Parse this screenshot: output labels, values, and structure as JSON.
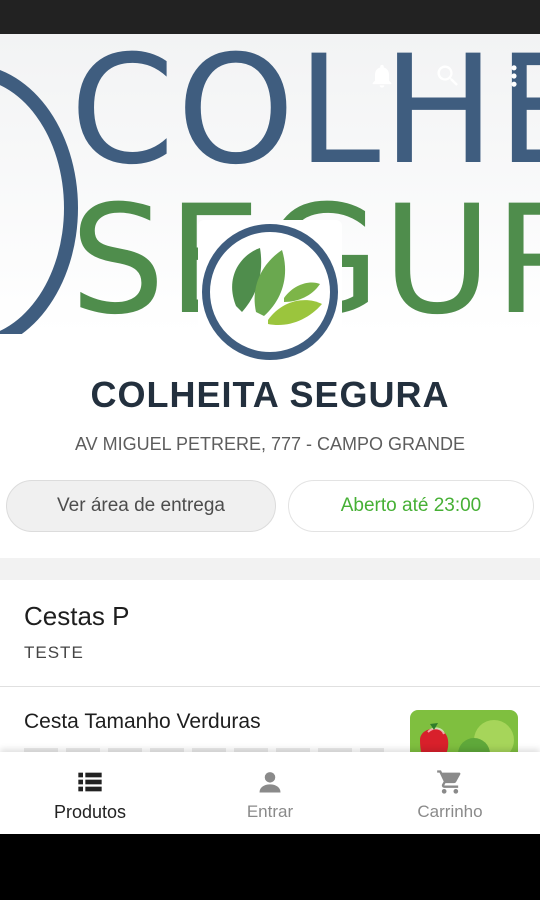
{
  "header": {
    "banner_word_top": "COLHE",
    "banner_word_bottom": "SEGUR",
    "actions": [
      {
        "icon": "bell-icon"
      },
      {
        "icon": "search-icon"
      },
      {
        "icon": "more-vert-icon"
      }
    ]
  },
  "store": {
    "name": "COLHEITA SEGURA",
    "address": "AV MIGUEL PETRERE, 777 - CAMPO GRANDE",
    "delivery_button": "Ver área de entrega",
    "hours_label": "Aberto até 23:00"
  },
  "catalog": {
    "category_title": "Cestas P",
    "category_subtitle": "TESTE",
    "products": [
      {
        "name": "Cesta Tamanho Verduras"
      }
    ]
  },
  "bottom_nav": {
    "items": [
      {
        "label": "Produtos",
        "icon": "list-icon",
        "active": true
      },
      {
        "label": "Entrar",
        "icon": "user-icon",
        "active": false
      },
      {
        "label": "Carrinho",
        "icon": "cart-icon",
        "active": false
      }
    ]
  },
  "colors": {
    "brand_blue": "#3f5d7f",
    "brand_green": "#4f8d4c",
    "open_green": "#46b035"
  }
}
